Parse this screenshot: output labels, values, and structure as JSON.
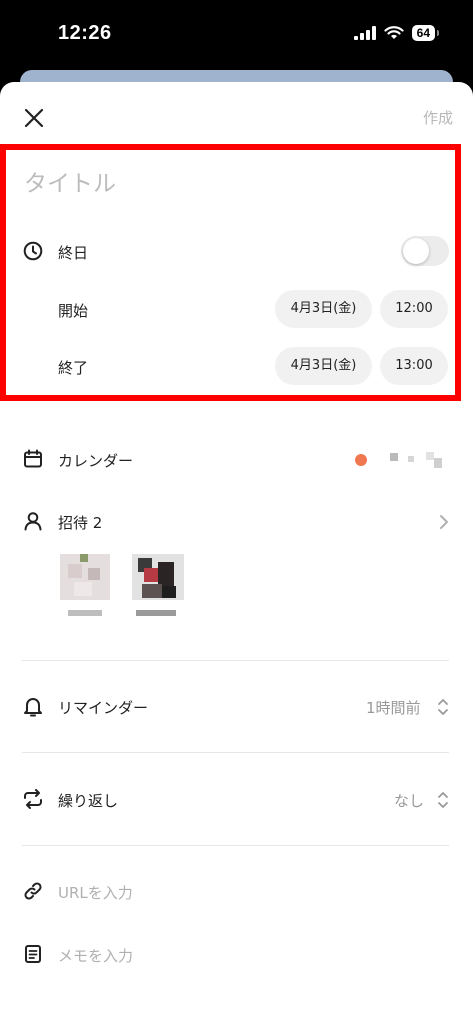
{
  "status_bar": {
    "time": "12:26",
    "battery": "64"
  },
  "header": {
    "create_label": "作成"
  },
  "form": {
    "title_placeholder": "タイトル",
    "all_day_label": "終日",
    "all_day_on": false,
    "start_label": "開始",
    "start_date": "4月3日(金)",
    "start_time": "12:00",
    "end_label": "終了",
    "end_date": "4月3日(金)",
    "end_time": "13:00"
  },
  "calendar": {
    "label": "カレンダー",
    "color": "#f07850"
  },
  "invite": {
    "label": "招待 2"
  },
  "reminder": {
    "label": "リマインダー",
    "value": "1時間前"
  },
  "repeat": {
    "label": "繰り返し",
    "value": "なし"
  },
  "url": {
    "placeholder": "URLを入力"
  },
  "memo": {
    "placeholder": "メモを入力"
  },
  "colors": {
    "highlight": "#ff0000",
    "pill_bg": "#f1f1f1"
  }
}
